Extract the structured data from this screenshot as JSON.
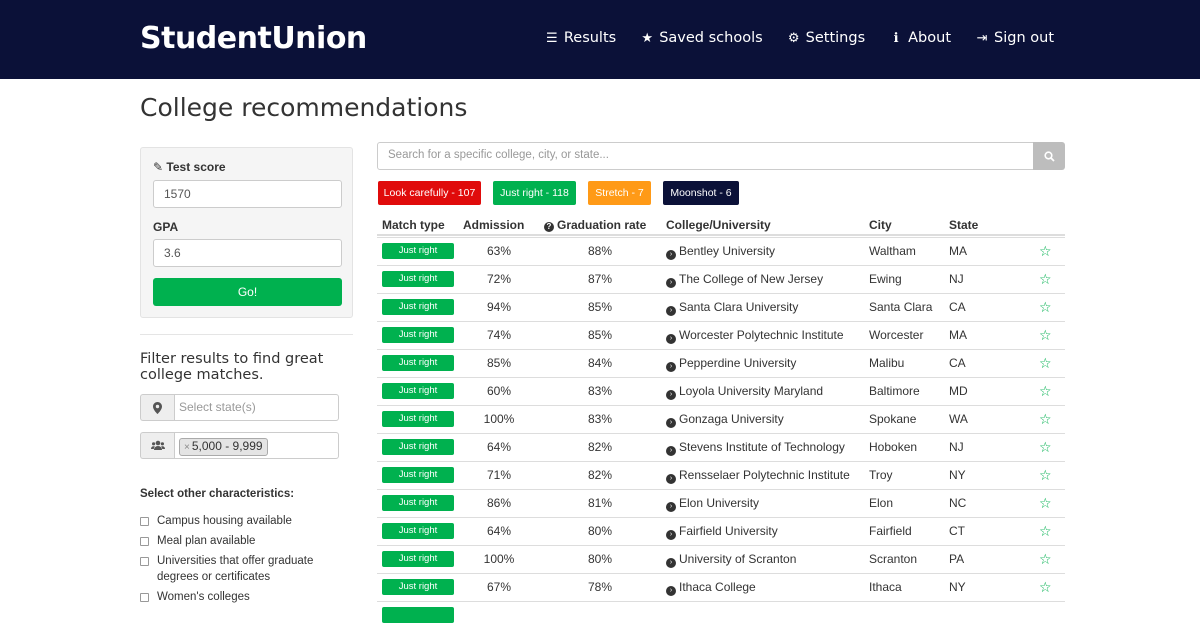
{
  "brand": "StudentUnion",
  "nav": [
    {
      "label": "Results",
      "icon": "list-icon",
      "glyph": "☰"
    },
    {
      "label": "Saved schools",
      "icon": "star-icon",
      "glyph": "★"
    },
    {
      "label": "Settings",
      "icon": "gear-icon",
      "glyph": "⚙"
    },
    {
      "label": "About",
      "icon": "info-icon",
      "glyph": "ℹ"
    },
    {
      "label": "Sign out",
      "icon": "sign-out-icon",
      "glyph": "⇥"
    }
  ],
  "page_title": "College recommendations",
  "form": {
    "test_score_label": "Test score",
    "test_score_value": "1570",
    "gpa_label": "GPA",
    "gpa_value": "3.6",
    "go_label": "Go!"
  },
  "filters": {
    "title": "Filter results to find great college matches.",
    "state_placeholder": "Select state(s)",
    "size_tag": "5,000 - 9,999",
    "characteristics_title": "Select other characteristics:",
    "characteristics": [
      "Campus housing available",
      "Meal plan available",
      "Universities that offer graduate degrees or certificates",
      "Women's colleges"
    ]
  },
  "search": {
    "placeholder": "Search for a specific college, city, or state..."
  },
  "match_filters": [
    {
      "label": "Look carefully - 107",
      "color": "#e00b0b"
    },
    {
      "label": "Just right - 118",
      "color": "#00b14f"
    },
    {
      "label": "Stretch - 7",
      "color": "#ff9a17"
    },
    {
      "label": "Moonshot - 6",
      "color": "#0b1138"
    }
  ],
  "table": {
    "headers": {
      "match_type": "Match type",
      "admission": "Admission",
      "graduation": "Graduation rate",
      "college": "College/University",
      "city": "City",
      "state": "State"
    },
    "rows": [
      {
        "match": "Just right",
        "admission": "63%",
        "graduation": "88%",
        "college": "Bentley University",
        "city": "Waltham",
        "state": "MA"
      },
      {
        "match": "Just right",
        "admission": "72%",
        "graduation": "87%",
        "college": "The College of New Jersey",
        "city": "Ewing",
        "state": "NJ"
      },
      {
        "match": "Just right",
        "admission": "94%",
        "graduation": "85%",
        "college": "Santa Clara University",
        "city": "Santa Clara",
        "state": "CA"
      },
      {
        "match": "Just right",
        "admission": "74%",
        "graduation": "85%",
        "college": "Worcester Polytechnic Institute",
        "city": "Worcester",
        "state": "MA"
      },
      {
        "match": "Just right",
        "admission": "85%",
        "graduation": "84%",
        "college": "Pepperdine University",
        "city": "Malibu",
        "state": "CA"
      },
      {
        "match": "Just right",
        "admission": "60%",
        "graduation": "83%",
        "college": "Loyola University Maryland",
        "city": "Baltimore",
        "state": "MD"
      },
      {
        "match": "Just right",
        "admission": "100%",
        "graduation": "83%",
        "college": "Gonzaga University",
        "city": "Spokane",
        "state": "WA"
      },
      {
        "match": "Just right",
        "admission": "64%",
        "graduation": "82%",
        "college": "Stevens Institute of Technology",
        "city": "Hoboken",
        "state": "NJ"
      },
      {
        "match": "Just right",
        "admission": "71%",
        "graduation": "82%",
        "college": "Rensselaer Polytechnic Institute",
        "city": "Troy",
        "state": "NY"
      },
      {
        "match": "Just right",
        "admission": "86%",
        "graduation": "81%",
        "college": "Elon University",
        "city": "Elon",
        "state": "NC"
      },
      {
        "match": "Just right",
        "admission": "64%",
        "graduation": "80%",
        "college": "Fairfield University",
        "city": "Fairfield",
        "state": "CT"
      },
      {
        "match": "Just right",
        "admission": "100%",
        "graduation": "80%",
        "college": "University of Scranton",
        "city": "Scranton",
        "state": "PA"
      },
      {
        "match": "Just right",
        "admission": "67%",
        "graduation": "78%",
        "college": "Ithaca College",
        "city": "Ithaca",
        "state": "NY"
      }
    ]
  }
}
